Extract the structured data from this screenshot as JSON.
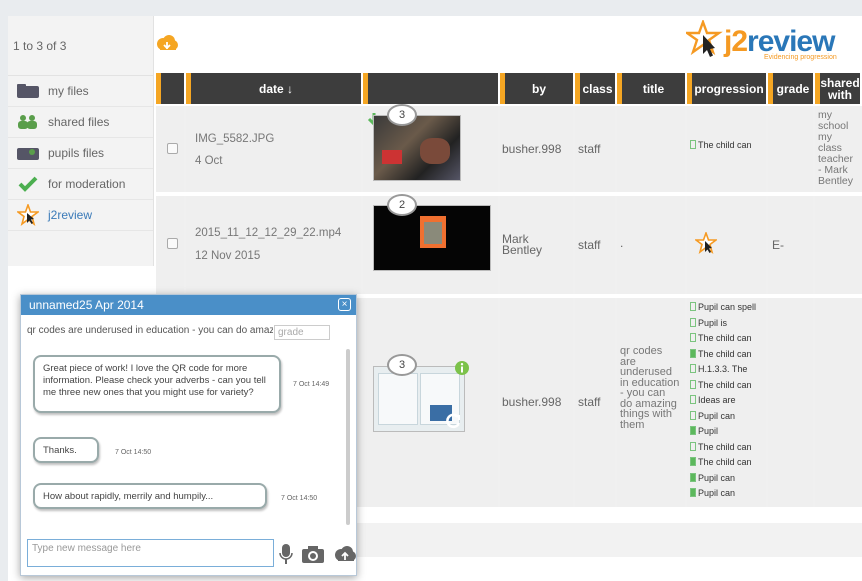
{
  "sidebar": {
    "count": "1 to 3 of 3",
    "items": [
      {
        "label": "my files",
        "icon": "folder-icon"
      },
      {
        "label": "shared files",
        "icon": "people-icon"
      },
      {
        "label": "pupils files",
        "icon": "pupils-icon"
      },
      {
        "label": "for moderation",
        "icon": "checkmark-icon"
      },
      {
        "label": "j2review",
        "icon": "star-cursor-icon"
      }
    ]
  },
  "logo": {
    "text_a": "j2",
    "text_b": "review",
    "tagline": "Evidencing progression"
  },
  "columns": [
    "date ↓",
    "by",
    "class",
    "title",
    "progression",
    "grade",
    "shared with"
  ],
  "rows": [
    {
      "filename": "IMG_5582.JPG",
      "date": "4 Oct",
      "comments": "3",
      "by": "busher.998",
      "class": "staff",
      "title": "",
      "progression": [
        "The child can"
      ],
      "grade": "",
      "shared_with": "my school my class teacher - Mark Bentley"
    },
    {
      "filename": "2015_11_12_12_29_22.mp4",
      "date": "12 Nov 2015",
      "comments": "2",
      "by": "Mark Bentley",
      "class": "staff",
      "title": ".",
      "progression": [],
      "grade": "E-",
      "shared_with": ""
    },
    {
      "filename": "",
      "date": "",
      "comments": "3",
      "by": "busher.998",
      "class": "staff",
      "title": "qr codes are underused in education - you can do amazing things with them",
      "progression": [
        "Pupil can spell",
        "Pupil is",
        "The child can",
        "The child can",
        "H.1.3.3. The",
        "The child can",
        "Ideas are",
        "Pupil can",
        "Pupil",
        "The child can",
        "The child can",
        "Pupil can",
        "Pupil can"
      ],
      "grade": "",
      "shared_with": ""
    }
  ],
  "chat": {
    "title": "unnamed25 Apr 2014",
    "close": "×",
    "subject": "qr codes are underused in education - you can do amazing things with them",
    "grade_placeholder": "grade",
    "messages": [
      {
        "text": "Great piece of work! I love the QR code for more information. Please check your adverbs - can you tell me three new ones that you might use for variety?",
        "time": "7 Oct 14:49"
      },
      {
        "text": "Thanks.",
        "time": "7 Oct 14:50"
      },
      {
        "text": "How about rapidly, merrily and humpily...",
        "time": "7 Oct 14:50"
      }
    ],
    "compose_placeholder": "Type new message here"
  },
  "colors": {
    "accent": "#f5a623",
    "brand": "#2a77b8",
    "header": "#3d3d3d",
    "chat_header": "#4a8fc8"
  }
}
